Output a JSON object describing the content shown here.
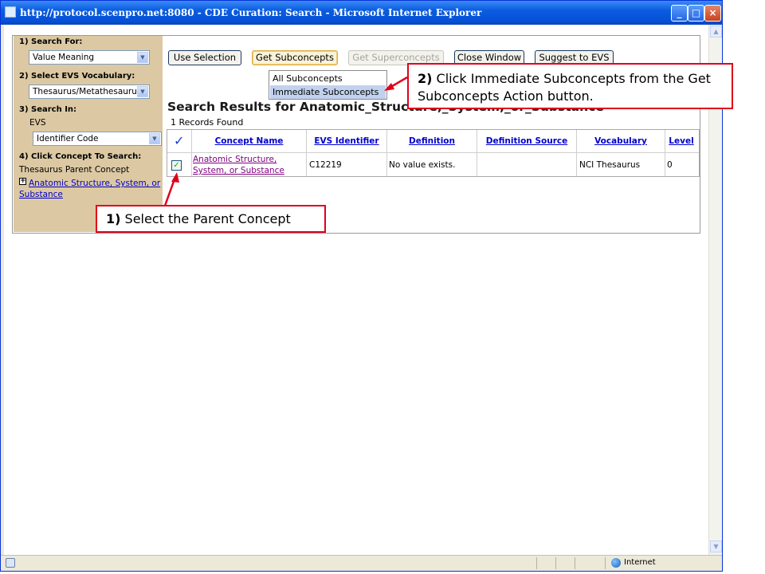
{
  "window": {
    "title": "http://protocol.scenpro.net:8080 - CDE Curation: Search - Microsoft Internet Explorer",
    "controls": {
      "minimize": "_",
      "maximize": "□",
      "close": "×"
    }
  },
  "statusbar": {
    "zone": "Internet"
  },
  "sidebar": {
    "search_for_label": "1) Search For:",
    "search_for_value": "Value Meaning",
    "vocab_label": "2) Select EVS Vocabulary:",
    "vocab_value": "Thesaurus/Metathesaurus",
    "search_in_label": "3) Search In:",
    "search_in_sub": "EVS",
    "search_in_value": "Identifier Code",
    "click_concept_label": "4) Click Concept To Search:",
    "parent_concept_label": "Thesaurus Parent Concept",
    "tree_link": "Anatomic Structure, System, or Substance",
    "tree_expander": "+"
  },
  "toolbar": {
    "use_selection": "Use Selection",
    "get_subconcepts": "Get Subconcepts",
    "get_superconcepts": "Get Superconcepts",
    "close_window": "Close Window",
    "suggest_to_evs": "Suggest to EVS"
  },
  "dropdown_menu": {
    "items": [
      "All Subconcepts",
      "Immediate Subconcepts"
    ],
    "highlight_color": "#c1d2ee"
  },
  "results": {
    "title": "Search Results for Anatomic_Structure,_System,_or_Substance",
    "count": "1 Records Found",
    "columns": [
      "Concept Name",
      "EVS Identifier",
      "Definition",
      "Definition Source",
      "Vocabulary",
      "Level"
    ],
    "rows": [
      {
        "checked": true,
        "concept_name": "Anatomic Structure, System, or Substance",
        "evs_identifier": "C12219",
        "definition": "No value exists.",
        "definition_source": "",
        "vocabulary": "NCI Thesaurus",
        "level": "0"
      }
    ]
  },
  "callouts": {
    "step1_number": "1)",
    "step1_text": " Select the Parent Concept",
    "step2_number": "2)",
    "step2_text": " Click Immediate Subconcepts from the Get Subconcepts Action button.",
    "border_color": "#e0001b"
  },
  "colors": {
    "titlebar": "#0a5ce0",
    "sidebar": "#dcc9a3",
    "link": "#0000cc",
    "visited_link": "#800080"
  }
}
